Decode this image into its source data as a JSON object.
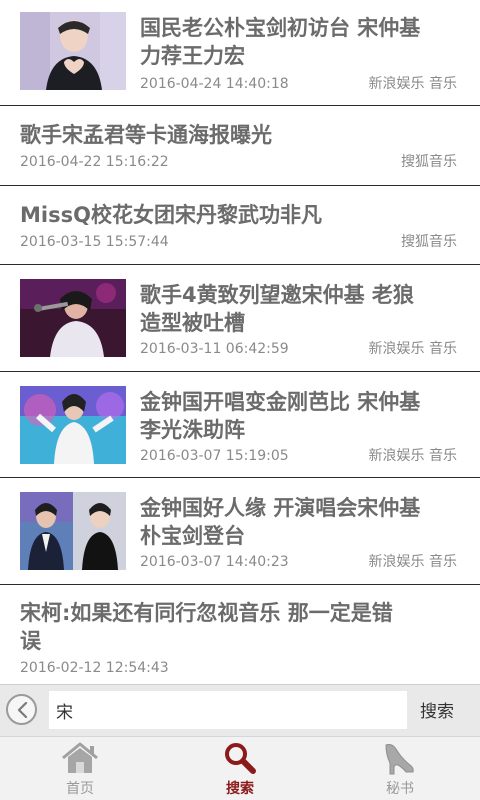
{
  "feed": {
    "items": [
      {
        "title_line1": "国民老公朴宝剑初访台 宋仲基",
        "title_line2": "力荐王力宏",
        "date": "2016-04-24 14:40:18",
        "source": "新浪娱乐 音乐"
      },
      {
        "title_line1": "歌手宋孟君等卡通海报曝光",
        "date": "2016-04-22 15:16:22",
        "source": "搜狐音乐"
      },
      {
        "title_line1": "MissQ校花女团宋丹黎武功非凡",
        "date": "2016-03-15 15:57:44",
        "source": "搜狐音乐"
      },
      {
        "title_line1": "歌手4黄致列望邀宋仲基 老狼",
        "title_line2": "造型被吐槽",
        "date": "2016-03-11 06:42:59",
        "source": "新浪娱乐 音乐"
      },
      {
        "title_line1": "金钟国开唱变金刚芭比 宋仲基",
        "title_line2": "李光洙助阵",
        "date": "2016-03-07 15:19:05",
        "source": "新浪娱乐 音乐"
      },
      {
        "title_line1": "金钟国好人缘 开演唱会宋仲基",
        "title_line2": "朴宝剑登台",
        "date": "2016-03-07 14:40:23",
        "source": "新浪娱乐 音乐"
      },
      {
        "title_line1": "宋柯:如果还有同行忽视音乐 那一定是错",
        "title_line2": "误",
        "date": "2016-02-12 12:54:43"
      }
    ]
  },
  "search": {
    "value": "宋",
    "button_label": "搜索"
  },
  "tabbar": {
    "home_label": "首页",
    "search_label": "搜索",
    "secretary_label": "秘书"
  },
  "colors": {
    "accent": "#8b1a1a",
    "text_title": "#6b6b6b",
    "text_meta": "#8a8a8a"
  }
}
